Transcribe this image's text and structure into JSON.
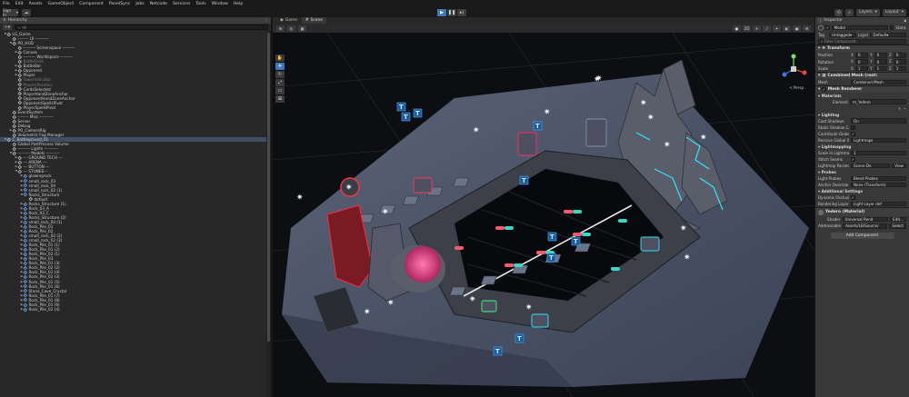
{
  "menu": [
    "File",
    "Edit",
    "Assets",
    "GameObject",
    "Component",
    "PanelSync",
    "Jobs",
    "Netcode",
    "Services",
    "Tools",
    "Window",
    "Help"
  ],
  "toolbar": {
    "signin_label": "Sign In",
    "layers_label": "Layers",
    "layout_label": "Layout"
  },
  "hierarchy": {
    "tab_label": "Hierarchy",
    "search_placeholder": "All",
    "add_label": "+",
    "rows": [
      {
        "text": "LG_Game",
        "indent": 0,
        "arrow": "▼",
        "sel": false,
        "dim": false,
        "icon": "scene"
      },
      {
        "text": "-------- UI ----------",
        "indent": 1,
        "arrow": "",
        "sel": false,
        "dim": false,
        "icon": "cube"
      },
      {
        "text": "PO_HUD",
        "indent": 1,
        "arrow": "▼",
        "sel": false,
        "dim": false,
        "icon": "cube"
      },
      {
        "text": "--------- Screenspace ---------",
        "indent": 2,
        "arrow": "",
        "sel": false,
        "dim": false,
        "icon": "cube"
      },
      {
        "text": "Canvas",
        "indent": 2,
        "arrow": "▶",
        "sel": false,
        "dim": false,
        "icon": "cube"
      },
      {
        "text": "--------- Worldspace ---------",
        "indent": 2,
        "arrow": "",
        "sel": false,
        "dim": false,
        "icon": "cube"
      },
      {
        "text": "BattleField",
        "indent": 2,
        "arrow": "",
        "sel": false,
        "dim": true,
        "icon": "cube"
      },
      {
        "text": "BattleBar",
        "indent": 2,
        "arrow": "▶",
        "sel": false,
        "dim": false,
        "icon": "cube"
      },
      {
        "text": "Opponent",
        "indent": 2,
        "arrow": "▶",
        "sel": false,
        "dim": false,
        "icon": "cube"
      },
      {
        "text": "Player",
        "indent": 2,
        "arrow": "▶",
        "sel": false,
        "dim": false,
        "icon": "cube"
      },
      {
        "text": "TowerIndicator",
        "indent": 2,
        "arrow": "",
        "sel": false,
        "dim": true,
        "icon": "cube"
      },
      {
        "text": "PlayersPosition",
        "indent": 2,
        "arrow": "",
        "sel": false,
        "dim": true,
        "icon": "cube"
      },
      {
        "text": "CardsSelected",
        "indent": 2,
        "arrow": "",
        "sel": false,
        "dim": false,
        "icon": "cube"
      },
      {
        "text": "PlayerHandZoneAnchor",
        "indent": 2,
        "arrow": "",
        "sel": false,
        "dim": false,
        "icon": "cube"
      },
      {
        "text": "OpponentHandZoneAnchor",
        "indent": 2,
        "arrow": "",
        "sel": false,
        "dim": false,
        "icon": "cube"
      },
      {
        "text": "OpponentSpellsPivot",
        "indent": 2,
        "arrow": "",
        "sel": false,
        "dim": false,
        "icon": "cube"
      },
      {
        "text": "PlayerSpellsPivot",
        "indent": 2,
        "arrow": "",
        "sel": false,
        "dim": false,
        "icon": "cube"
      },
      {
        "text": "EventSystem",
        "indent": 1,
        "arrow": "",
        "sel": false,
        "dim": false,
        "icon": "cube"
      },
      {
        "text": "-------- Misc ----------",
        "indent": 1,
        "arrow": "",
        "sel": false,
        "dim": false,
        "icon": "cube"
      },
      {
        "text": "Server",
        "indent": 1,
        "arrow": "",
        "sel": false,
        "dim": false,
        "icon": "cube"
      },
      {
        "text": "Debug",
        "indent": 1,
        "arrow": "",
        "sel": false,
        "dim": false,
        "icon": "cube"
      },
      {
        "text": "PO_CameraRig",
        "indent": 1,
        "arrow": "▶",
        "sel": false,
        "dim": false,
        "icon": "cube"
      },
      {
        "text": "Volumetric Fog Manager",
        "indent": 1,
        "arrow": "",
        "sel": false,
        "dim": false,
        "icon": "cube"
      },
      {
        "text": "C_Battleground_01",
        "indent": 0,
        "arrow": "▼",
        "sel": true,
        "dim": false,
        "icon": "scene"
      },
      {
        "text": "Global PostProcess Volume",
        "indent": 1,
        "arrow": "",
        "sel": false,
        "dim": false,
        "icon": "cube"
      },
      {
        "text": "--------- Lights ----------",
        "indent": 1,
        "arrow": "",
        "sel": false,
        "dim": false,
        "icon": "cube"
      },
      {
        "text": "--------- Models ----------",
        "indent": 1,
        "arrow": "▼",
        "sel": false,
        "dim": false,
        "icon": "cube"
      },
      {
        "text": "--- GROUND TECH ---",
        "indent": 2,
        "arrow": "▶",
        "sel": false,
        "dim": false,
        "icon": "cube"
      },
      {
        "text": "--- ARENA ---",
        "indent": 2,
        "arrow": "▶",
        "sel": false,
        "dim": false,
        "icon": "cube"
      },
      {
        "text": "--- BUTTON ---",
        "indent": 2,
        "arrow": "▶",
        "sel": false,
        "dim": false,
        "icon": "cube"
      },
      {
        "text": "--- STONES---",
        "indent": 2,
        "arrow": "▼",
        "sel": false,
        "dim": false,
        "icon": "cube"
      },
      {
        "text": "glowingrock",
        "indent": 3,
        "arrow": "▶",
        "sel": false,
        "dim": false,
        "icon": "blue"
      },
      {
        "text": "small_rock_03",
        "indent": 3,
        "arrow": "▶",
        "sel": false,
        "dim": false,
        "icon": "blue"
      },
      {
        "text": "small_rock_04",
        "indent": 3,
        "arrow": "▶",
        "sel": false,
        "dim": false,
        "icon": "blue"
      },
      {
        "text": "small_rock_02 (1)",
        "indent": 3,
        "arrow": "▶",
        "sel": false,
        "dim": false,
        "icon": "blue"
      },
      {
        "text": "Rocks_Structure",
        "indent": 3,
        "arrow": "▼",
        "sel": false,
        "dim": false,
        "icon": "blue"
      },
      {
        "text": "default",
        "indent": 4,
        "arrow": "",
        "sel": false,
        "dim": false,
        "icon": "cube"
      },
      {
        "text": "Rocks_Structure (1)",
        "indent": 3,
        "arrow": "▶",
        "sel": false,
        "dim": false,
        "icon": "blue"
      },
      {
        "text": "Rock_03_A",
        "indent": 3,
        "arrow": "▶",
        "sel": false,
        "dim": false,
        "icon": "blue"
      },
      {
        "text": "Rock_03_C",
        "indent": 3,
        "arrow": "▶",
        "sel": false,
        "dim": false,
        "icon": "blue"
      },
      {
        "text": "Rocks_Structure (2)",
        "indent": 3,
        "arrow": "▶",
        "sel": false,
        "dim": false,
        "icon": "blue"
      },
      {
        "text": "small_rock_04 (1)",
        "indent": 3,
        "arrow": "▶",
        "sel": false,
        "dim": false,
        "icon": "blue"
      },
      {
        "text": "Rock_Pile_01",
        "indent": 3,
        "arrow": "▶",
        "sel": false,
        "dim": false,
        "icon": "blue"
      },
      {
        "text": "Rock_Pile_02",
        "indent": 3,
        "arrow": "▶",
        "sel": false,
        "dim": false,
        "icon": "blue"
      },
      {
        "text": "small_rock_02 (2)",
        "indent": 3,
        "arrow": "▶",
        "sel": false,
        "dim": false,
        "icon": "blue"
      },
      {
        "text": "small_rock_02 (3)",
        "indent": 3,
        "arrow": "▶",
        "sel": false,
        "dim": false,
        "icon": "blue"
      },
      {
        "text": "Rock_Pile_01 (1)",
        "indent": 3,
        "arrow": "▶",
        "sel": false,
        "dim": false,
        "icon": "blue"
      },
      {
        "text": "Rock_Pile_01 (2)",
        "indent": 3,
        "arrow": "▶",
        "sel": false,
        "dim": false,
        "icon": "blue"
      },
      {
        "text": "Rock_Pile_02 (1)",
        "indent": 3,
        "arrow": "▶",
        "sel": false,
        "dim": false,
        "icon": "blue"
      },
      {
        "text": "Rock_Pile_03",
        "indent": 3,
        "arrow": "▶",
        "sel": false,
        "dim": false,
        "icon": "blue"
      },
      {
        "text": "Rock_Pile_01 (3)",
        "indent": 3,
        "arrow": "▶",
        "sel": false,
        "dim": false,
        "icon": "blue"
      },
      {
        "text": "Rock_Pile_02 (2)",
        "indent": 3,
        "arrow": "▶",
        "sel": false,
        "dim": false,
        "icon": "blue"
      },
      {
        "text": "Rock_Pile_01 (4)",
        "indent": 3,
        "arrow": "▶",
        "sel": false,
        "dim": false,
        "icon": "blue"
      },
      {
        "text": "Rock_Pile_02 (3)",
        "indent": 3,
        "arrow": "▶",
        "sel": false,
        "dim": false,
        "icon": "blue"
      },
      {
        "text": "Rock_Pile_01 (5)",
        "indent": 3,
        "arrow": "▶",
        "sel": false,
        "dim": false,
        "icon": "blue"
      },
      {
        "text": "Rock_Pile_01 (6)",
        "indent": 3,
        "arrow": "▶",
        "sel": false,
        "dim": false,
        "icon": "blue"
      },
      {
        "text": "Stone_Cave_Crystal",
        "indent": 3,
        "arrow": "▶",
        "sel": false,
        "dim": false,
        "icon": "blue"
      },
      {
        "text": "Rock_Pile_01 (7)",
        "indent": 3,
        "arrow": "▶",
        "sel": false,
        "dim": false,
        "icon": "blue"
      },
      {
        "text": "Rock_Pile_01 (8)",
        "indent": 3,
        "arrow": "▶",
        "sel": false,
        "dim": false,
        "icon": "blue"
      },
      {
        "text": "Rock_Pile_01 (9)",
        "indent": 3,
        "arrow": "▶",
        "sel": false,
        "dim": false,
        "icon": "blue"
      },
      {
        "text": "Rock_Pile_02 (4)",
        "indent": 3,
        "arrow": "▶",
        "sel": false,
        "dim": false,
        "icon": "blue"
      }
    ]
  },
  "scene": {
    "tab_game": "Game",
    "tab_scene": "Scene",
    "persp_label": "< Persp"
  },
  "inspector": {
    "tab_label": "Inspector",
    "object_name": "Model",
    "static_label": "Static",
    "tag_label": "Tag",
    "tag_value": "Untagged",
    "layer_label": "Layer",
    "layer_value": "Default",
    "filter_placeholder": "Filter Component",
    "transform_title": "Transform",
    "position_label": "Position",
    "position": {
      "x": "0",
      "y": "0",
      "z": "0"
    },
    "rotation_label": "Rotation",
    "rotation": {
      "x": "0",
      "y": "0",
      "z": "0"
    },
    "scale_label": "Scale",
    "scale": {
      "x": "1",
      "y": "1",
      "z": "1"
    },
    "combined_mesh_title": "Combined Mesh (root:",
    "mesh_label": "Mesh",
    "mesh_value": "Combined Mesh",
    "mesh_renderer_title": "Mesh Renderer",
    "materials_label": "Materials",
    "element_label": "Element",
    "element_value": "m_Yedero",
    "lighting_label": "Lighting",
    "cast_shadows_label": "Cast Shadows",
    "cast_shadows_value": "On",
    "static_shadow_label": "Static Shadow Ca",
    "contribute_gi_label": "Contribute Global",
    "receive_gi_label": "Receive Global Il",
    "receive_gi_value": "Lightmaps",
    "lightmapping_label": "Lightmapping",
    "scale_lightmap_label": "Scale In Lightmap",
    "scale_lightmap_value": "1",
    "stitch_seams_label": "Stitch Seams",
    "lightmap_param_label": "Lightmap Paramet",
    "lightmap_param_value": "Scene De",
    "view_label": "View",
    "probes_label": "Probes",
    "light_probes_label": "Light Probes",
    "light_probes_value": "Blend Probes",
    "anchor_override_label": "Anchor Override",
    "anchor_override_value": "None (Transform)",
    "additional_label": "Additional Settings",
    "dynamic_occ_label": "Dynamic Occlusi",
    "rendering_layer_label": "Rendering Layer M",
    "rendering_layer_value": "Light Layer def",
    "material_name": "Yedero (Material)",
    "shader_label": "Shader",
    "shader_value": "Universal Rend",
    "edit_label": "Edit...",
    "addressable_label": "Addressable",
    "addressable_value": "Assets/LB/Source/",
    "select_label": "Select",
    "add_component_label": "Add Component"
  }
}
